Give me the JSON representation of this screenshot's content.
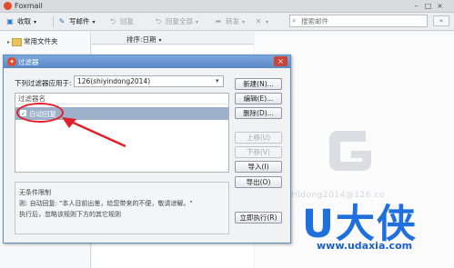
{
  "app": {
    "title": "Foxmail"
  },
  "window_controls": [
    "–",
    "□",
    "×"
  ],
  "toolbar": {
    "receive": "收取",
    "compose": "写邮件",
    "reply": "回复",
    "reply_all": "回复全部",
    "forward": "转发",
    "search_placeholder": "搜索邮件",
    "collapse": "«"
  },
  "folders": {
    "common": "常用文件夹"
  },
  "mail_list": {
    "sort_label": "排序:日期"
  },
  "watermark": {
    "text": "Hidong2014@126.co"
  },
  "brand": {
    "mark": "U大侠",
    "url": "www.udaxia.com"
  },
  "dialog": {
    "title": "过滤器",
    "apply_label": "下列过滤器应用于:",
    "account": "126(shiyindong2014)",
    "list_header": "过滤器名",
    "filters": [
      {
        "name": "自动回复",
        "checked": true
      }
    ],
    "description": [
      "无条件限制",
      "则: 自动回复: \"本人目前出差，给您带来的不便，敬请谅解。\"",
      "执行后，忽略该规则下方的其它规则"
    ],
    "buttons": {
      "new": "新建(N)...",
      "edit": "编辑(E)...",
      "delete": "删除(D)...",
      "move_up": "上移(U)",
      "move_down": "下移(V)",
      "import": "导入(I)",
      "export": "导出(O)",
      "run_now": "立即执行(R)"
    }
  },
  "colors": {
    "accent": "#5b89c6",
    "highlight": "#e0202a",
    "brand": "#1f6fdc"
  }
}
